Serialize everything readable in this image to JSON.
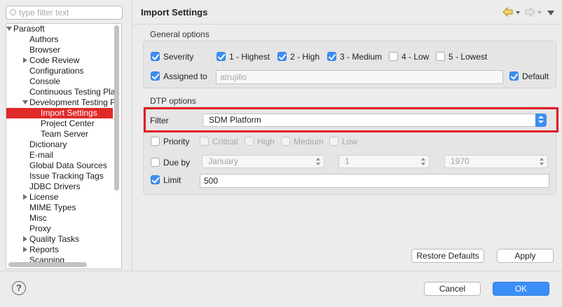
{
  "filter": {
    "placeholder": "type filter text"
  },
  "tree": {
    "items": [
      {
        "label": "Parasoft",
        "twisty": "down"
      },
      {
        "label": "Authors"
      },
      {
        "label": "Browser"
      },
      {
        "label": "Code Review",
        "twisty": "right"
      },
      {
        "label": "Configurations"
      },
      {
        "label": "Console"
      },
      {
        "label": "Continuous Testing Pla"
      },
      {
        "label": "Development Testing P",
        "twisty": "down"
      },
      {
        "label": "Import Settings",
        "selected": true
      },
      {
        "label": "Project Center"
      },
      {
        "label": "Team Server"
      },
      {
        "label": "Dictionary"
      },
      {
        "label": "E-mail"
      },
      {
        "label": "Global Data Sources"
      },
      {
        "label": "Issue Tracking Tags"
      },
      {
        "label": "JDBC Drivers"
      },
      {
        "label": "License",
        "twisty": "right"
      },
      {
        "label": "MIME Types"
      },
      {
        "label": "Misc"
      },
      {
        "label": "Proxy"
      },
      {
        "label": "Quality Tasks",
        "twisty": "right"
      },
      {
        "label": "Reports",
        "twisty": "right"
      },
      {
        "label": "Scanning"
      }
    ]
  },
  "header": {
    "title": "Import Settings",
    "back_icon": "arrow-left-icon",
    "forward_icon": "arrow-right-icon",
    "menu_icon": "view-menu-icon"
  },
  "general": {
    "title": "General options",
    "severity": {
      "label": "Severity",
      "checked": true,
      "levels": [
        {
          "label": "1 - Highest",
          "checked": true
        },
        {
          "label": "2 - High",
          "checked": true
        },
        {
          "label": "3 - Medium",
          "checked": true
        },
        {
          "label": "4 - Low",
          "checked": false
        },
        {
          "label": "5 - Lowest",
          "checked": false
        }
      ]
    },
    "assigned": {
      "label": "Assigned to",
      "checked": true,
      "value": "atrujillo"
    },
    "default": {
      "label": "Default",
      "checked": true
    }
  },
  "dtp": {
    "title": "DTP options",
    "filter": {
      "label": "Filter",
      "value": "SDM Platform"
    },
    "priority": {
      "label": "Priority",
      "checked": false,
      "levels": [
        {
          "label": "Critical",
          "checked": false
        },
        {
          "label": "High",
          "checked": false
        },
        {
          "label": "Medium",
          "checked": false
        },
        {
          "label": "Low",
          "checked": false
        }
      ]
    },
    "due_by": {
      "label": "Due by",
      "checked": false,
      "month": "January",
      "day": "1",
      "year": "1970"
    },
    "limit": {
      "label": "Limit",
      "checked": true,
      "value": "500"
    }
  },
  "buttons": {
    "restore_defaults": "Restore Defaults",
    "apply": "Apply",
    "cancel": "Cancel",
    "ok": "OK",
    "help": "?"
  },
  "colors": {
    "accent": "#3d8ef0",
    "selection": "#e02a2a",
    "highlight_border": "#e01b24"
  }
}
